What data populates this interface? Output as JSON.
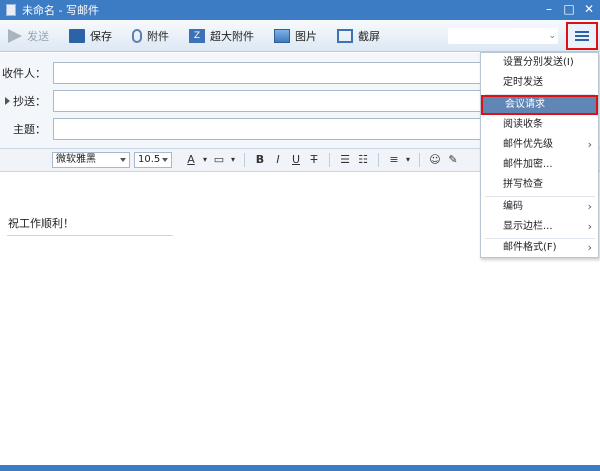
{
  "window": {
    "title": "未命名 - 写邮件"
  },
  "toolbar": {
    "send": "发送",
    "save": "保存",
    "attach": "附件",
    "big_attach": "超大附件",
    "picture": "图片",
    "screenshot": "截屏",
    "account": "⌄"
  },
  "fields": {
    "to_label": "收件人：",
    "cc_label": "抄送：",
    "subject_label": "主题："
  },
  "format": {
    "font": "微软雅黑",
    "size": "10.5"
  },
  "body": {
    "text": "祝工作顺利！"
  },
  "menu": {
    "items": [
      {
        "label": "设置分别发送(I)",
        "submenu": false
      },
      {
        "label": "定时发送",
        "submenu": false
      },
      {
        "label": "会议请求",
        "submenu": false,
        "active": true
      },
      {
        "label": "阅读收条",
        "submenu": false
      },
      {
        "label": "邮件优先级",
        "submenu": true
      },
      {
        "label": "邮件加密...",
        "submenu": false
      },
      {
        "label": "拼写检查",
        "submenu": false
      },
      {
        "label": "编码",
        "submenu": true
      },
      {
        "label": "显示边栏...",
        "submenu": true
      },
      {
        "label": "邮件格式(F)",
        "submenu": true
      }
    ],
    "submenu_arrow": "›"
  },
  "colors": {
    "titlebar": "#3b7cc4",
    "highlight": "#5f86b5",
    "callout": "#d11111"
  }
}
